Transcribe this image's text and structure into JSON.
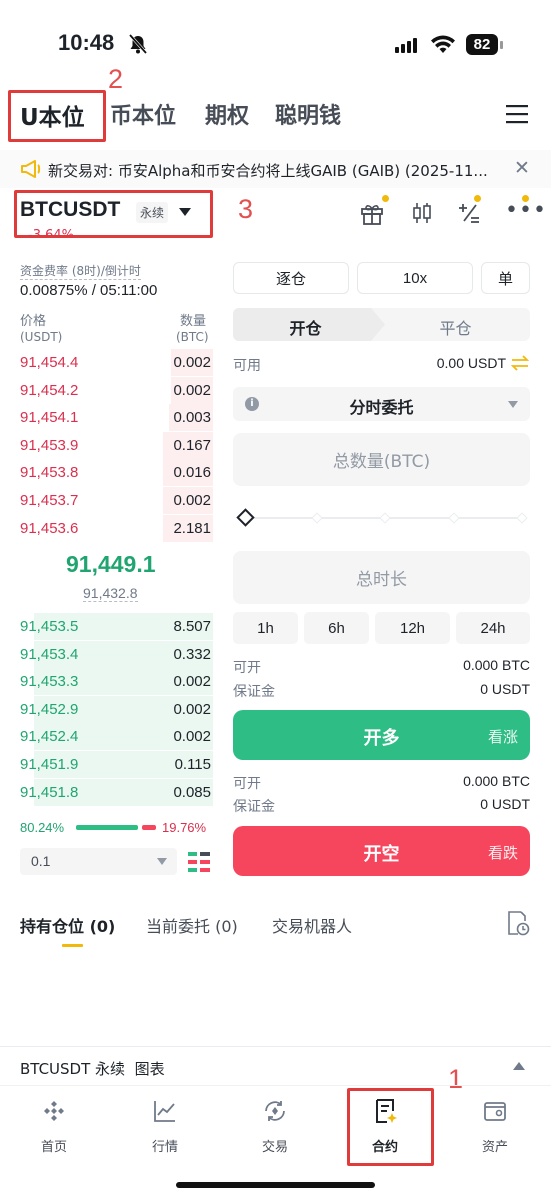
{
  "status": {
    "time": "10:48",
    "battery": "82"
  },
  "annotations": {
    "n1": "1",
    "n2": "2",
    "n3": "3"
  },
  "top_tabs": [
    "U本位",
    "币本位",
    "期权",
    "聪明钱"
  ],
  "announcement": "新交易对: 币安Alpha和币安合约将上线GAIB (GAIB) (2025-11...",
  "ticker": {
    "symbol": "BTCUSDT",
    "type_badge": "永续",
    "change": "-3.64%"
  },
  "funding": {
    "label": "资金费率 (8时)/倒计时",
    "value": "0.00875% / 05:11:00"
  },
  "orderbook": {
    "price_label": "价格",
    "price_unit": "(USDT)",
    "qty_label": "数量",
    "qty_unit": "(BTC)",
    "asks": [
      {
        "price": "91,454.4",
        "qty": "0.002",
        "depth": 0.22
      },
      {
        "price": "91,454.2",
        "qty": "0.002",
        "depth": 0.22
      },
      {
        "price": "91,454.1",
        "qty": "0.003",
        "depth": 0.23
      },
      {
        "price": "91,453.9",
        "qty": "0.167",
        "depth": 0.26
      },
      {
        "price": "91,453.8",
        "qty": "0.016",
        "depth": 0.26
      },
      {
        "price": "91,453.7",
        "qty": "0.002",
        "depth": 0.26
      },
      {
        "price": "91,453.6",
        "qty": "2.181",
        "depth": 0.26
      }
    ],
    "last_price": "91,449.1",
    "mark_price": "91,432.8",
    "bids": [
      {
        "price": "91,453.5",
        "qty": "8.507",
        "depth": 0.93
      },
      {
        "price": "91,453.4",
        "qty": "0.332",
        "depth": 0.93
      },
      {
        "price": "91,453.3",
        "qty": "0.002",
        "depth": 0.93
      },
      {
        "price": "91,452.9",
        "qty": "0.002",
        "depth": 0.93
      },
      {
        "price": "91,452.4",
        "qty": "0.002",
        "depth": 0.93
      },
      {
        "price": "91,451.9",
        "qty": "0.115",
        "depth": 0.93
      },
      {
        "price": "91,451.8",
        "qty": "0.085",
        "depth": 0.93
      }
    ],
    "buy_pct": "80.24%",
    "sell_pct": "19.76%",
    "buy_ratio": 0.8024,
    "precision": "0.1"
  },
  "form": {
    "margin_mode": "逐仓",
    "leverage": "10x",
    "position_mode": "单",
    "open_tab": "开仓",
    "close_tab": "平仓",
    "available_label": "可用",
    "available_value": "0.00 USDT",
    "order_type": "分时委托",
    "total_qty_placeholder": "总数量(BTC)",
    "slider_value": 0,
    "duration_placeholder": "总时长",
    "durations": [
      "1h",
      "6h",
      "12h",
      "24h"
    ],
    "long": {
      "can_open_label": "可开",
      "can_open_value": "0.000 BTC",
      "margin_label": "保证金",
      "margin_value": "0 USDT",
      "button": "开多",
      "hint": "看涨"
    },
    "short": {
      "can_open_label": "可开",
      "can_open_value": "0.000 BTC",
      "margin_label": "保证金",
      "margin_value": "0 USDT",
      "button": "开空",
      "hint": "看跌"
    }
  },
  "positions_tabs": [
    "持有仓位 (0)",
    "当前委托 (0)",
    "交易机器人"
  ],
  "chart_bar": "BTCUSDT 永续  图表",
  "bottom_nav": [
    "首页",
    "行情",
    "交易",
    "合约",
    "资产"
  ],
  "colors": {
    "buy": "#2ebd85",
    "sell": "#f6465d",
    "accent": "#f0b90b"
  }
}
